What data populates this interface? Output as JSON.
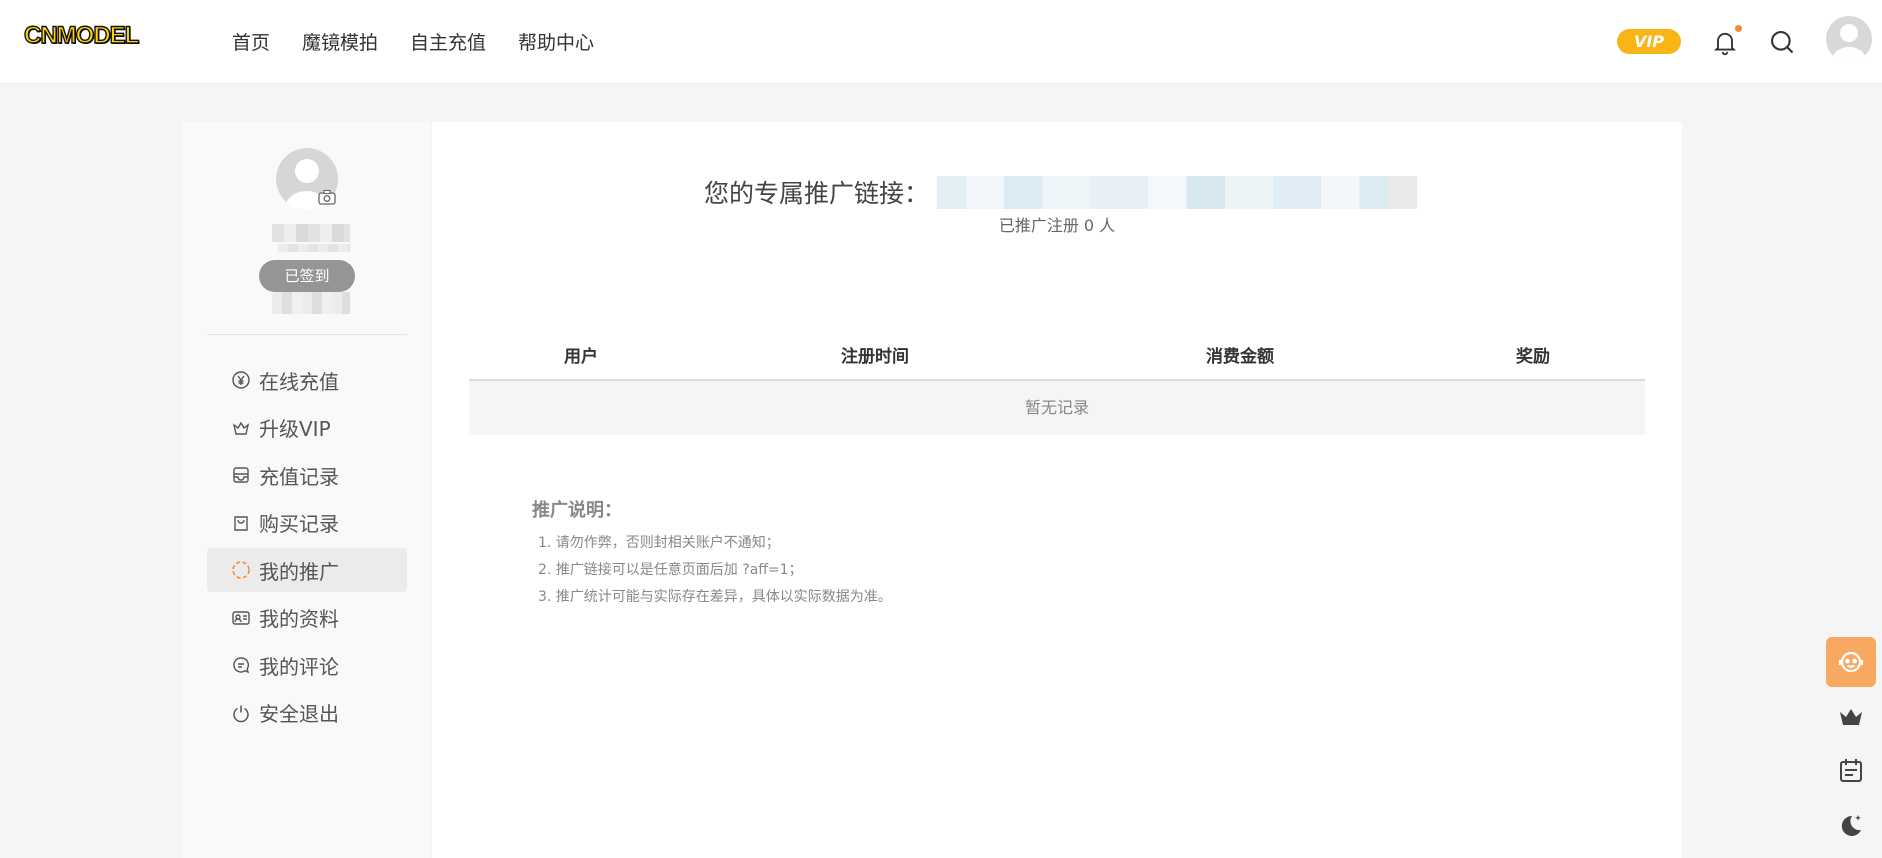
{
  "header": {
    "logo": "CNMODEL",
    "nav": [
      "首页",
      "魔镜模拍",
      "自主充值",
      "帮助中心"
    ],
    "vip_badge": "VIP"
  },
  "sidebar": {
    "signin_label": "已签到",
    "menu": [
      {
        "label": "在线充值",
        "icon": "yuan-circle-icon"
      },
      {
        "label": "升级VIP",
        "icon": "crown-icon"
      },
      {
        "label": "充值记录",
        "icon": "wallet-icon"
      },
      {
        "label": "购买记录",
        "icon": "shopping-bag-icon"
      },
      {
        "label": "我的推广",
        "icon": "share-icon",
        "active": true
      },
      {
        "label": "我的资料",
        "icon": "id-card-icon"
      },
      {
        "label": "我的评论",
        "icon": "comment-icon"
      },
      {
        "label": "安全退出",
        "icon": "power-icon"
      }
    ]
  },
  "main": {
    "link_label": "您的专属推广链接：",
    "promo_count": "已推广注册 0 人",
    "table": {
      "headers": [
        "用户",
        "注册时间",
        "消费金额",
        "奖励"
      ],
      "empty_text": "暂无记录"
    },
    "notes_title": "推广说明：",
    "notes": [
      "1. 请勿作弊，否则封相关账户不通知；",
      "2. 推广链接可以是任意页面后加 ?aff=1；",
      "3. 推广统计可能与实际存在差异，具体以实际数据为准。"
    ]
  },
  "colors": {
    "accent_orange": "#f9a861",
    "vip_yellow": "#f8b515",
    "active_icon": "#f08a34"
  }
}
